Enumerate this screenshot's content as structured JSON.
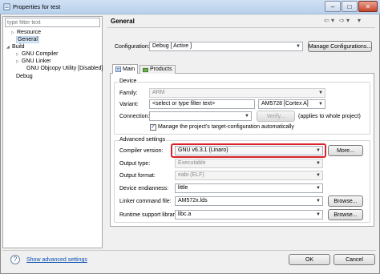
{
  "window": {
    "title": "Properties for test"
  },
  "filter": {
    "placeholder": "type filter text"
  },
  "tree": {
    "items": [
      {
        "label": "Resource",
        "level": 1,
        "expandable": true
      },
      {
        "label": "General",
        "level": 1,
        "expandable": false,
        "selected": true
      },
      {
        "label": "Build",
        "level": 0,
        "expandable": true
      },
      {
        "label": "GNU Compiler",
        "level": 1,
        "expandable": true
      },
      {
        "label": "GNU Linker",
        "level": 1,
        "expandable": true
      },
      {
        "label": "GNU Objcopy Utility  [Disabled]",
        "level": 1,
        "expandable": false
      },
      {
        "label": "Debug",
        "level": 0,
        "expandable": false
      }
    ]
  },
  "header": {
    "title": "General"
  },
  "configuration": {
    "label": "Configuration:",
    "value": "Debug  [ Active ]",
    "manage_button": "Manage Configurations..."
  },
  "tabs": [
    {
      "label": "Main",
      "active": true
    },
    {
      "label": "Products",
      "active": false
    }
  ],
  "device": {
    "group_title": "Device",
    "family_label": "Family:",
    "family_value": "ARM",
    "variant_label": "Variant:",
    "variant_filter": "<select or type filter text>",
    "variant_value": "AM5728 [Cortex A]",
    "connection_label": "Connection:",
    "connection_value": "",
    "verify_button": "Verify...",
    "applies_text": "(applies to whole project)",
    "manage_target_checkbox": "Manage the project's target-configuration automatically",
    "manage_target_checked": true
  },
  "advanced": {
    "group_title": "Advanced settings",
    "compiler_label": "Compiler version:",
    "compiler_value": "GNU v6.3.1 (Linaro)",
    "more_button": "More...",
    "output_type_label": "Output type:",
    "output_type_value": "Executable",
    "output_format_label": "Output format:",
    "output_format_value": "eabi (ELF)",
    "endianness_label": "Device endianness:",
    "endianness_value": "little",
    "linker_label": "Linker command file:",
    "linker_value": "AM572x.lds",
    "runtime_label": "Runtime support library:",
    "runtime_value": "libc.a",
    "browse_label": "Browse..."
  },
  "footer": {
    "show_advanced": "Show advanced settings",
    "ok_button": "OK",
    "cancel_button": "Cancel"
  },
  "colors": {
    "highlight_border": "#d9232a",
    "link": "#0b4fb3"
  }
}
